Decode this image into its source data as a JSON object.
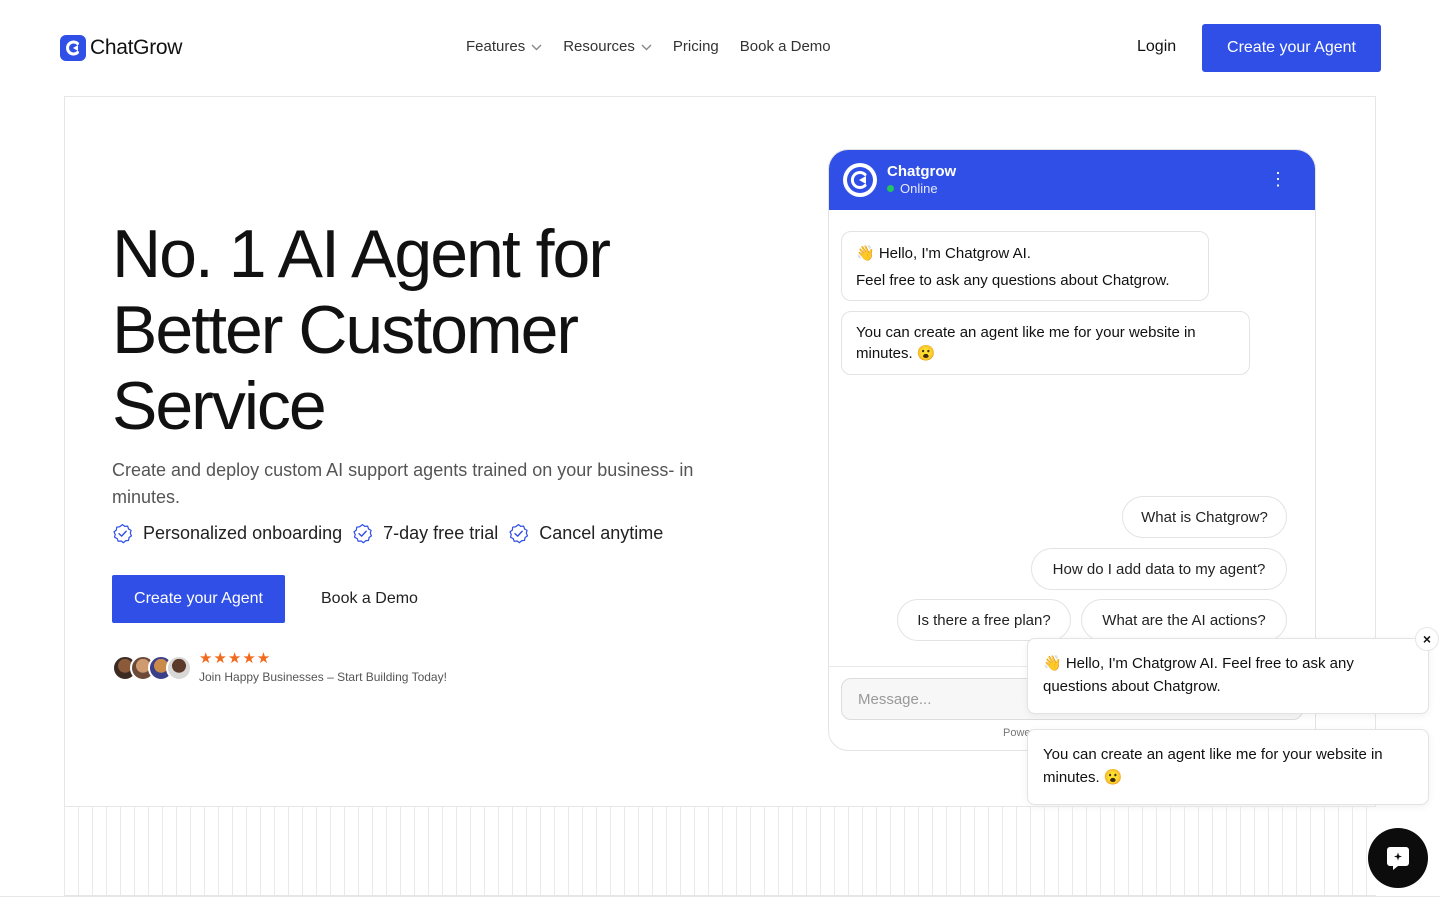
{
  "nav": {
    "brand": "ChatGrow",
    "links": [
      {
        "label": "Features"
      },
      {
        "label": "Resources"
      },
      {
        "label": "Pricing"
      },
      {
        "label": "Book a Demo"
      }
    ],
    "login": "Login",
    "cta": "Create your Agent"
  },
  "hero": {
    "title": "No. 1 AI Agent for Better Customer Service",
    "subtitle": "Create and deploy custom AI support agents trained on your business- in minutes.",
    "features": [
      "Personalized onboarding",
      "7-day free trial",
      "Cancel anytime"
    ],
    "primary_cta": "Create your Agent",
    "secondary_cta": "Book a Demo",
    "rating": "★★★★★",
    "social_proof": "Join Happy Businesses – Start Building Today!"
  },
  "chat": {
    "name": "Chatgrow",
    "status": "Online",
    "menu": "⋮",
    "greeting_line1": "👋 Hello, I'm Chatgrow AI.",
    "greeting_line2": "Feel free to ask any questions about Chatgrow.",
    "message2": "You can create an agent like me for your website in minutes. 😮",
    "suggestions": [
      "What is Chatgrow?",
      "How do I add data to my agent?",
      "Is there a free plan?",
      "What are the AI actions?"
    ],
    "input_placeholder": "Message...",
    "powered": "Powe"
  },
  "popup": {
    "message1": "👋 Hello, I'm Chatgrow AI. Feel free to ask any questions about Chatgrow.",
    "message2": "You can create an agent like me for your website in minutes. 😮",
    "close": "×"
  },
  "colors": {
    "brand": "#2f4fe6",
    "star": "#f26a1b",
    "online": "#22c55e"
  }
}
